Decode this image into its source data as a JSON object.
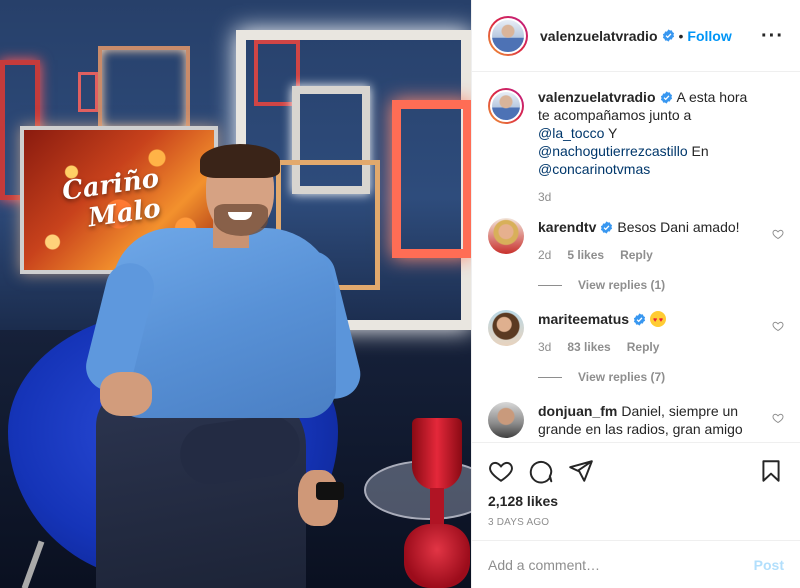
{
  "photo": {
    "tv_text_line1": "Cariño",
    "tv_text_line2": "Malo"
  },
  "header": {
    "username": "valenzuelatvradio",
    "dot": "•",
    "follow_label": "Follow",
    "more_icon": "more-horizontal-icon",
    "more_label": "···"
  },
  "caption": {
    "username": "valenzuelatvradio",
    "text_before": "A esta hora te acompañamos junto a ",
    "mention1": "@la_tocco",
    "text_mid": " Y ",
    "mention2": "@nachogutierrezcastillo",
    "text_en": " En ",
    "mention3": "@concarinotvmas",
    "time": "3d"
  },
  "comments": [
    {
      "username": "karendtv",
      "text": "Besos Dani amado!",
      "time": "2d",
      "likes": "5 likes",
      "reply": "Reply",
      "view_replies": "View replies (1)"
    },
    {
      "username": "mariteematus",
      "text": "",
      "emoji": "heart-eyes-emoji",
      "time": "3d",
      "likes": "83 likes",
      "reply": "Reply",
      "view_replies": "View replies (7)"
    },
    {
      "username": "donjuan_fm",
      "text": "Daniel, siempre un grande en las radios, gran amigo todos los dias. El Cariño Malo de"
    }
  ],
  "actions": {
    "like_icon": "heart-icon",
    "comment_icon": "comment-icon",
    "share_icon": "share-icon",
    "bookmark_icon": "bookmark-icon",
    "likes": "2,128 likes",
    "date": "3 DAYS AGO"
  },
  "add_comment": {
    "placeholder": "Add a comment…",
    "post_label": "Post"
  },
  "colors": {
    "link_blue": "#0095f6",
    "mention_blue": "#00376b",
    "muted": "#8e8e8e",
    "post_disabled": "#b2dffc",
    "verified_blue": "#3897f0"
  }
}
